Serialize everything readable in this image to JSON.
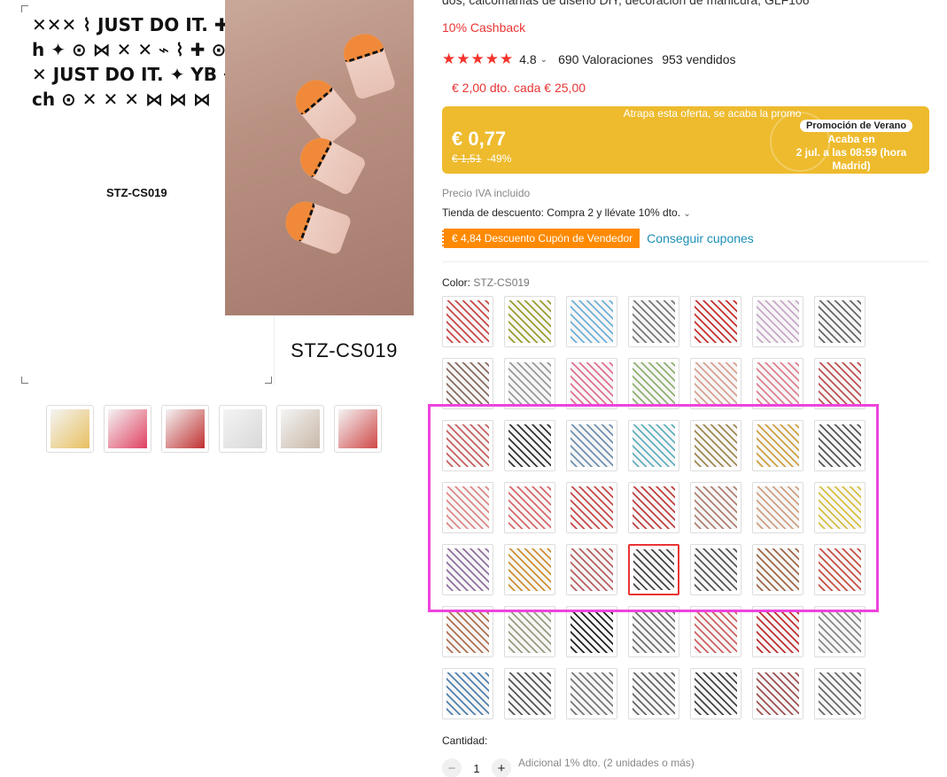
{
  "product": {
    "title_fragment": "dos, calcomanías de diseño DIY, decoración de manicura, GLF106",
    "cashback": "10% Cashback",
    "rating": "4.8",
    "reviews": "690 Valoraciones",
    "sold": "953 vendidos",
    "promo": "€ 2,00 dto. cada € 25,00"
  },
  "gallery": {
    "sheet_code": "STZ-CS019",
    "photo_label": "STZ-CS019",
    "sheet_glyphs": "✕✕✕ ⌇ JUST DO IT. ✚ rich ✦ ⊙ ⋈ ✕ ✕ ⌁ ⌇ ✚ ⊙ ⋈ ✕ JUST DO IT. ✦ YB ⌁ rich ⊙ ✕ ✕ ✕ ⋈ ⋈ ⋈",
    "thumbnails": [
      "#e8c060",
      "#e04060",
      "#c03030",
      "#d8d8d8",
      "#c8b8a8",
      "#d04848"
    ]
  },
  "deal": {
    "header": "Atrapa esta oferta, se acaba la promo",
    "price": "€ 0,77",
    "old_price": "€ 1,51",
    "discount": "-49%",
    "badge": "Promoción de Verano",
    "ends_line1": "Acaba en",
    "ends_line2": "2 jul. a las 08:59 (hora Madrid)"
  },
  "vat": "Precio IVA incluido",
  "store_discount": "Tienda de descuento: Compra 2 y llévate 10% dto.",
  "coupon": {
    "tag": "€ 4,84 Descuento Cupón de Vendedor",
    "link": "Conseguir cupones"
  },
  "color": {
    "label": "Color:",
    "selected": "STZ-CS019"
  },
  "swatches": [
    "#c94848",
    "#9aa02c",
    "#6fb0d8",
    "#777777",
    "#c83030",
    "#c8a8c8",
    "#666666",
    "#8a6a60",
    "#999999",
    "#e07090",
    "#8fb070",
    "#d8a090",
    "#e08090",
    "#c05050",
    "#c86060",
    "#333333",
    "#7090b0",
    "#60b0c0",
    "#a08850",
    "#d0a040",
    "#555555",
    "#e08888",
    "#d86868",
    "#c84848",
    "#c04040",
    "#b08070",
    "#d0a080",
    "#d8c040",
    "#9070a0",
    "#d09030",
    "#b86060",
    "#444444",
    "#555555",
    "#a06848",
    "#c85040",
    "#b07050",
    "#9a9a80",
    "#222222",
    "#707070",
    "#d06060",
    "#c03030",
    "#888888",
    "#5080b0",
    "#555555",
    "#777777",
    "#666666",
    "#444444",
    "#a05050",
    "#6a6a6a"
  ],
  "selected_swatch_index": 31,
  "quantity": {
    "label": "Cantidad:",
    "minus": "−",
    "plus": "+",
    "value": "1",
    "note": "Adicional 1% dto. (2 unidades o más)"
  }
}
